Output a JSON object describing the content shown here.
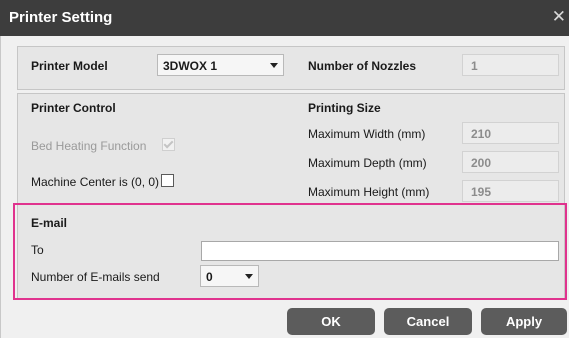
{
  "window": {
    "title": "Printer Setting",
    "close_glyph": "✕"
  },
  "printer_model": {
    "label": "Printer Model",
    "value": "3DWOX 1"
  },
  "nozzles": {
    "label": "Number of Nozzles",
    "value": "1"
  },
  "printer_control": {
    "heading": "Printer Control",
    "bed_heating": {
      "label": "Bed Heating Function",
      "checked": true,
      "enabled": false
    },
    "machine_center": {
      "label": "Machine Center is (0, 0)",
      "checked": false
    }
  },
  "printing_size": {
    "heading": "Printing Size",
    "width": {
      "label": "Maximum Width (mm)",
      "value": "210"
    },
    "depth": {
      "label": "Maximum Depth (mm)",
      "value": "200"
    },
    "height": {
      "label": "Maximum Height (mm)",
      "value": "195"
    }
  },
  "email": {
    "heading": "E-mail",
    "to_label": "To",
    "to_value": "",
    "count_label": "Number of E-mails send",
    "count_value": "0"
  },
  "buttons": {
    "ok": "OK",
    "cancel": "Cancel",
    "apply": "Apply"
  },
  "colors": {
    "title_bar": "#3d3d3d",
    "button": "#5c5c5c",
    "highlight": "#e0338e"
  }
}
